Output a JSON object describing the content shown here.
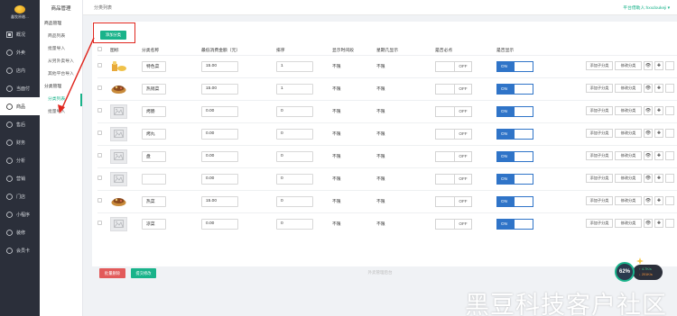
{
  "sidebar": {
    "logo_text": "鑫牧原缴…",
    "items": [
      {
        "label": "概况",
        "icon": "dashboard-icon"
      },
      {
        "label": "外卖",
        "icon": "delivery-icon"
      },
      {
        "label": "店内",
        "icon": "store-icon"
      },
      {
        "label": "当面付",
        "icon": "pay-icon"
      },
      {
        "label": "商品",
        "icon": "goods-icon",
        "active": true
      },
      {
        "label": "售后",
        "icon": "aftersale-icon"
      },
      {
        "label": "财务",
        "icon": "finance-icon"
      },
      {
        "label": "分析",
        "icon": "analysis-icon"
      },
      {
        "label": "营销",
        "icon": "marketing-icon"
      },
      {
        "label": "门店",
        "icon": "shop-icon"
      },
      {
        "label": "小程序",
        "icon": "miniapp-icon"
      },
      {
        "label": "装修",
        "icon": "decorate-icon"
      },
      {
        "label": "会员卡",
        "icon": "card-icon"
      }
    ]
  },
  "subnav": {
    "title": "商品管理",
    "items": [
      {
        "label": "商品管理",
        "group": true
      },
      {
        "label": "商品列表"
      },
      {
        "label": "批量导入"
      },
      {
        "label": "从另外卖导入"
      },
      {
        "label": "其他平台导入"
      },
      {
        "label": "分类管理",
        "group": true
      },
      {
        "label": "分类列表",
        "active": true
      },
      {
        "label": "批量导入"
      }
    ]
  },
  "header": {
    "breadcrumb": "分类列表",
    "user": "平台借助人:hxxdoukeji ▾"
  },
  "toolbar": {
    "add_label": "添加分类"
  },
  "table": {
    "columns": [
      "图标",
      "分类名称",
      "最低消费金额（元）",
      "排序",
      "显示时间段",
      "星期几显示",
      "是否必点",
      "是否显示"
    ],
    "rows": [
      {
        "img": "food",
        "name": "特色菜",
        "min": "15.00",
        "sort": "1",
        "time": "不限",
        "week": "不限",
        "must": "OFF",
        "show": "ON"
      },
      {
        "img": "food2",
        "name": "热销菜",
        "min": "15.00",
        "sort": "1",
        "time": "不限",
        "week": "不限",
        "must": "OFF",
        "show": "ON"
      },
      {
        "img": "none",
        "name": "烤肠",
        "min": "0.00",
        "sort": "0",
        "time": "不限",
        "week": "不限",
        "must": "OFF",
        "show": "ON"
      },
      {
        "img": "none",
        "name": "烤丸",
        "min": "0.00",
        "sort": "0",
        "time": "不限",
        "week": "不限",
        "must": "OFF",
        "show": "ON"
      },
      {
        "img": "none",
        "name": "盘",
        "min": "0.00",
        "sort": "0",
        "time": "不限",
        "week": "不限",
        "must": "OFF",
        "show": "ON"
      },
      {
        "img": "none",
        "name": "",
        "min": "0.00",
        "sort": "0",
        "time": "不限",
        "week": "不限",
        "must": "OFF",
        "show": "ON"
      },
      {
        "img": "food2",
        "name": "热菜",
        "min": "15.00",
        "sort": "0",
        "time": "不限",
        "week": "不限",
        "must": "OFF",
        "show": "ON"
      },
      {
        "img": "none",
        "name": "凉菜",
        "min": "0.00",
        "sort": "0",
        "time": "不限",
        "week": "不限",
        "must": "OFF",
        "show": "ON"
      }
    ],
    "actions": {
      "add_child": "添加子分类",
      "edit": "修改分类",
      "view": "👁",
      "plus": "✚"
    }
  },
  "bottom": {
    "batch_delete": "批量删除",
    "submit": "提交修改"
  },
  "footer": "外卖管理后台",
  "widget": {
    "percent": "62%",
    "up": "↑ 4.7K/s",
    "down": "↓ 201K/s"
  },
  "watermark": "黑豆科技客户社区",
  "colors": {
    "accent": "#19b38a",
    "toggle_on": "#2f74c8",
    "danger": "#e25a5a",
    "highlight": "#e0271f"
  }
}
